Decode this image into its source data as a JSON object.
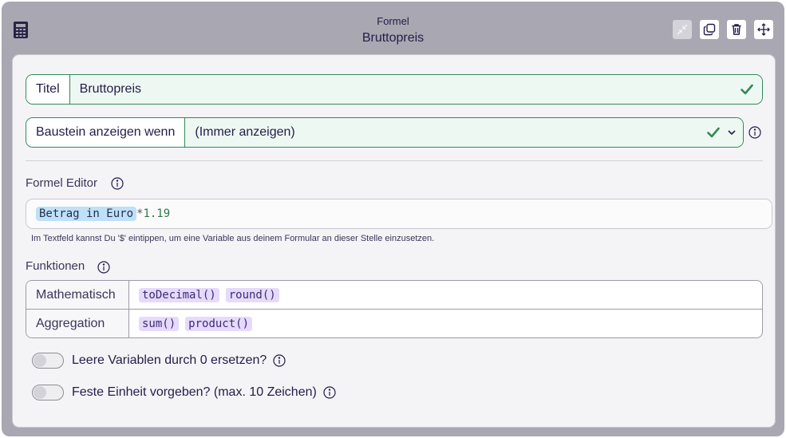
{
  "header": {
    "subtitle": "Formel",
    "title": "Bruttopreis",
    "buttons": [
      "collapse-icon",
      "copy-icon",
      "trash-icon",
      "move-icon"
    ]
  },
  "titel_field": {
    "label": "Titel",
    "value": "Bruttopreis"
  },
  "condition_field": {
    "label": "Baustein anzeigen wenn",
    "value": "(Immer anzeigen)"
  },
  "formula_editor": {
    "label": "Formel Editor",
    "variable": "Betrag in Euro",
    "operator": "*",
    "number": "1.19",
    "hint": "Im Textfeld kannst Du '$' eintippen, um eine Variable aus deinem Formular an dieser Stelle einzusetzen."
  },
  "functions": {
    "label": "Funktionen",
    "rows": [
      {
        "category": "Mathematisch",
        "items": [
          "toDecimal()",
          "round()"
        ]
      },
      {
        "category": "Aggregation",
        "items": [
          "sum()",
          "product()"
        ]
      }
    ]
  },
  "toggles": [
    {
      "label": "Leere Variablen durch 0 ersetzen?",
      "on": false
    },
    {
      "label": "Feste Einheit vorgeben? (max. 10 Zeichen)",
      "on": false
    }
  ],
  "colors": {
    "accent_green": "#2e8a57",
    "chip_purple": "#e6dafc",
    "variable_blue": "#bfe0f7"
  }
}
